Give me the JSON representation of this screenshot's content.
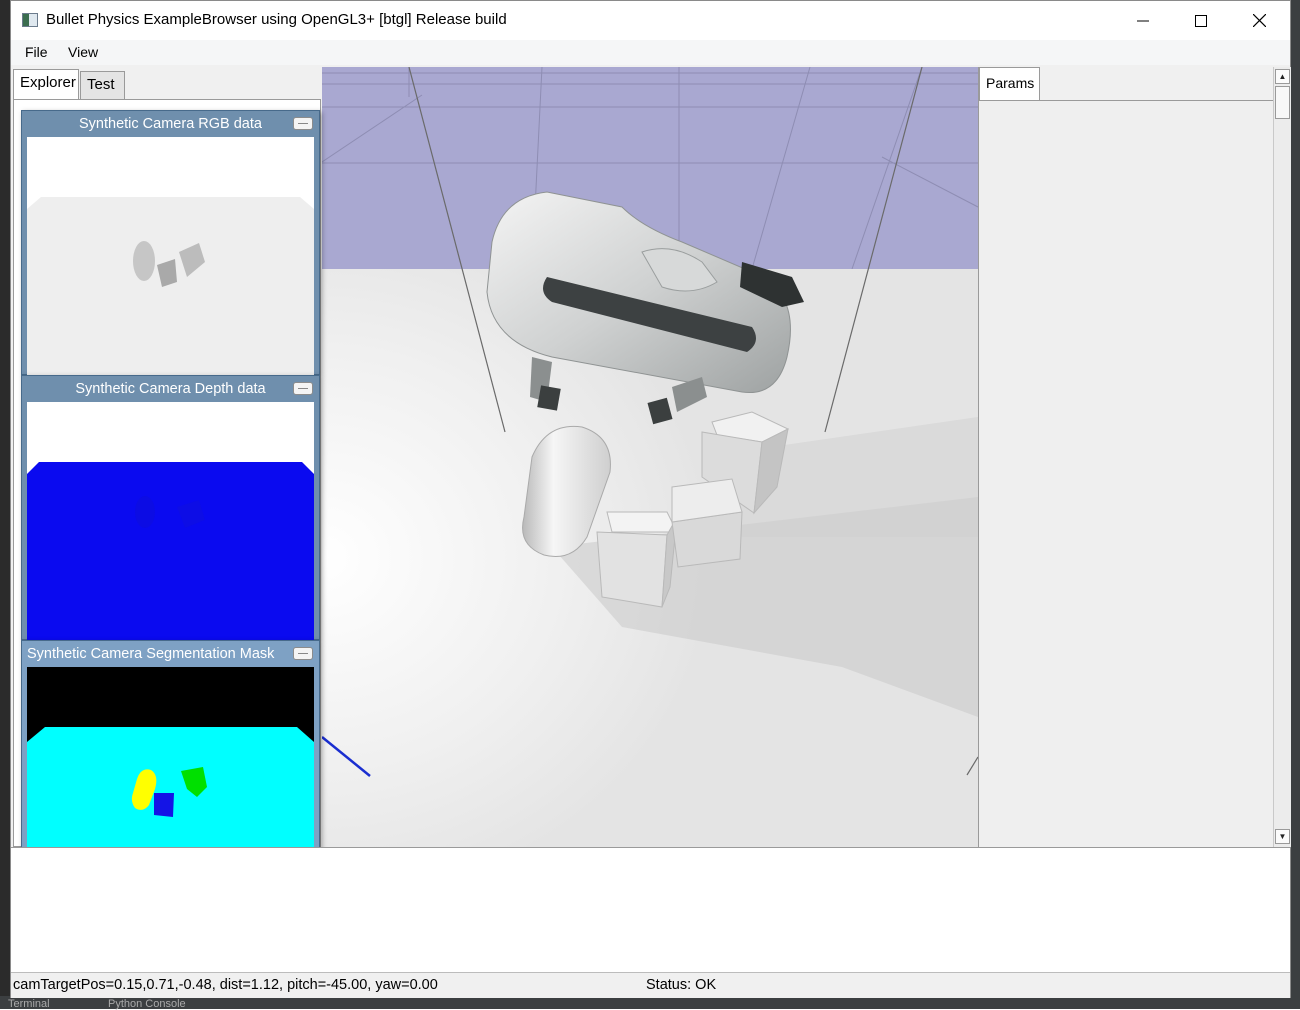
{
  "window": {
    "title": "Bullet Physics ExampleBrowser using OpenGL3+ [btgl] Release build"
  },
  "menu": [
    "File",
    "View"
  ],
  "left_tabs": [
    "Explorer",
    "Test"
  ],
  "camera_windows": [
    {
      "title": "Synthetic Camera RGB data"
    },
    {
      "title": "Synthetic Camera Depth data"
    },
    {
      "title": "Synthetic Camera Segmentation Mask"
    }
  ],
  "params": {
    "tab_label": "Params"
  },
  "status": {
    "camera": "camTargetPos=0.15,0.71,-0.48, dist=1.12, pitch=-45.00, yaw=0.00",
    "state": "Status: OK"
  },
  "background_taskbar": [
    "Terminal",
    "Python Console"
  ],
  "colors": {
    "sky": "#a9a8d1",
    "floor": "#e6e6e6",
    "camera_titlebar": "#6f8fad",
    "depth_blue": "#0a0af0",
    "segmentation_cyan": "#00ffff"
  }
}
